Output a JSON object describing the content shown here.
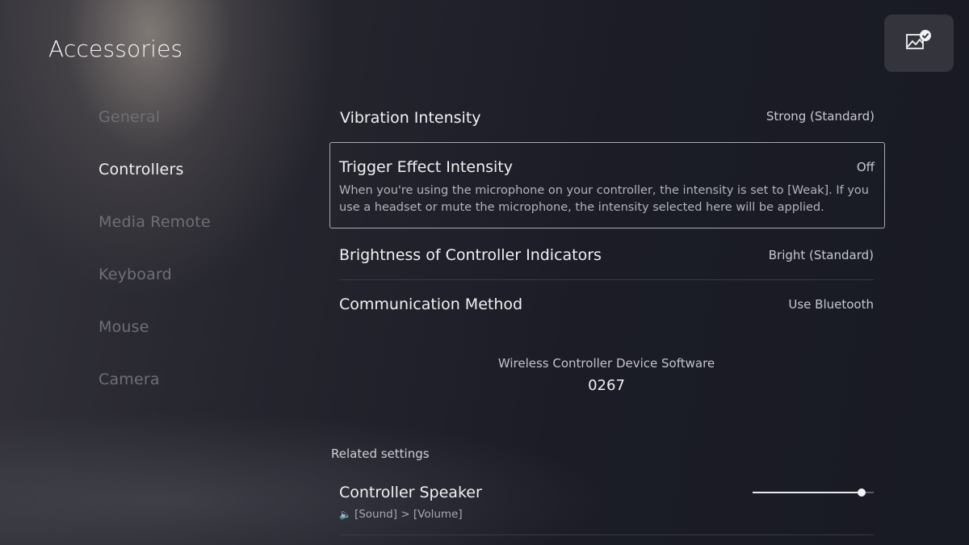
{
  "page": {
    "title": "Accessories"
  },
  "sidebar": {
    "items": [
      {
        "label": "General"
      },
      {
        "label": "Controllers"
      },
      {
        "label": "Media Remote"
      },
      {
        "label": "Keyboard"
      },
      {
        "label": "Mouse"
      },
      {
        "label": "Camera"
      }
    ],
    "selected": "Controllers"
  },
  "settings": {
    "vibration": {
      "label": "Vibration Intensity",
      "value": "Strong (Standard)"
    },
    "trigger": {
      "label": "Trigger Effect Intensity",
      "value": "Off",
      "description": "When you're using the microphone on your controller, the intensity is set to [Weak]. If you use a headset or mute the microphone, the intensity selected here will be applied."
    },
    "brightness": {
      "label": "Brightness of Controller Indicators",
      "value": "Bright (Standard)"
    },
    "communication": {
      "label": "Communication Method",
      "value": "Use Bluetooth"
    }
  },
  "firmware": {
    "label": "Wireless Controller Device Software",
    "version": "0267"
  },
  "related": {
    "heading": "Related settings",
    "speaker": {
      "label": "Controller Speaker",
      "path": "[Sound] > [Volume]",
      "level": 0.9
    }
  },
  "icons": {
    "corner": "screenshot-check-icon",
    "speaker": "speaker-icon"
  },
  "colors": {
    "focus_border": "#a9a9b3",
    "inactive_text": "#6f6f77",
    "active_text": "#f0f0f2"
  }
}
